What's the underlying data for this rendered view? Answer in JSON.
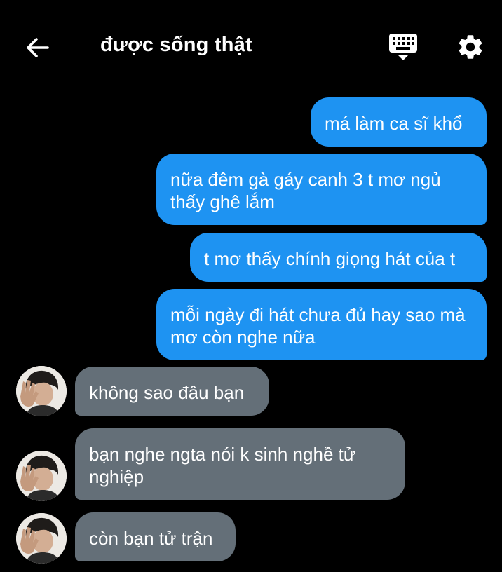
{
  "header": {
    "title": "được sống thật",
    "back_icon": "arrow-left-icon",
    "keyboard_icon": "keyboard-icon",
    "settings_icon": "gear-icon"
  },
  "colors": {
    "background": "#000000",
    "outgoing_bubble": "#1e93f2",
    "incoming_bubble": "#646f78",
    "text": "#ffffff"
  },
  "messages": [
    {
      "direction": "outgoing",
      "text": "má làm ca sĩ khổ"
    },
    {
      "direction": "outgoing",
      "text": "nữa đêm gà gáy canh 3 t mơ ngủ thấy ghê lắm"
    },
    {
      "direction": "outgoing",
      "text": "t mơ thấy chính giọng hát của t"
    },
    {
      "direction": "outgoing",
      "text": "mỗi ngày đi hát chưa đủ hay sao mà mơ còn nghe nữa"
    },
    {
      "direction": "incoming",
      "text": "không sao đâu bạn"
    },
    {
      "direction": "incoming",
      "text": "bạn nghe ngta nói k sinh nghề tử nghiệp"
    },
    {
      "direction": "incoming",
      "text": "còn bạn tử trận"
    }
  ]
}
